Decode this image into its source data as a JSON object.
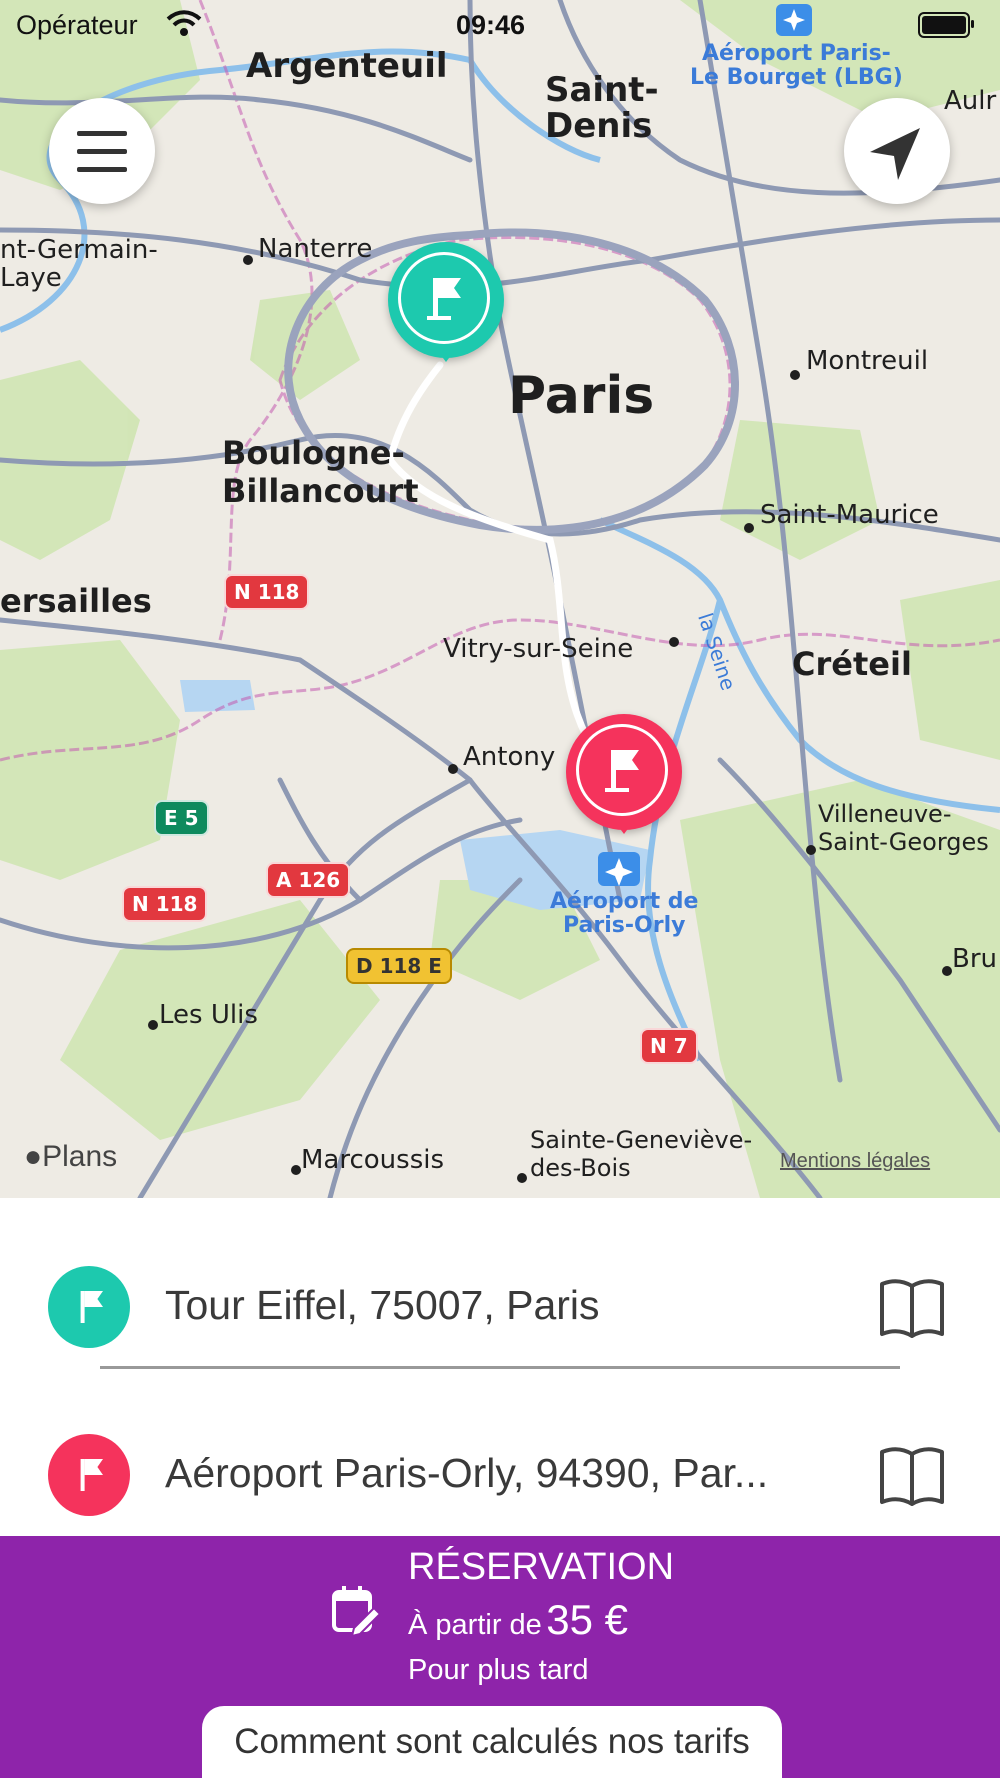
{
  "status_bar": {
    "carrier": "Opérateur",
    "time": "09:46"
  },
  "map": {
    "labels": {
      "argenteuil": "Argenteuil",
      "saint_denis": "Saint-\nDenis",
      "aulnay": "Aulr",
      "le_bourget": "Aéroport Paris-\nLe Bourget (LBG)",
      "st_germain": "nt-Germain-\nLaye",
      "nanterre": "Nanterre",
      "paris": "Paris",
      "montreuil": "Montreuil",
      "boulogne": "Boulogne-\nBillancourt",
      "saint_maurice": "Saint-Maurice",
      "versailles": "ersailles",
      "vitry": "Vitry-sur-Seine",
      "seine": "la Seine",
      "creteil": "Créteil",
      "antony": "Antony",
      "villeneuve": "Villeneuve-\nSaint-Georges",
      "orly": "Aéroport de\nParis-Orly",
      "les_ulis": "Les Ulis",
      "bru": "Bru",
      "marcoussis": "Marcoussis",
      "sainte_genevieve": "Sainte-Geneviève-\ndes-Bois"
    },
    "shields": {
      "n118_a": "N 118",
      "e5": "E 5",
      "a126": "A 126",
      "n118_b": "N 118",
      "d118e": "D 118 E",
      "n7": "N 7"
    },
    "attribution": "Plans",
    "legal": "Mentions légales"
  },
  "addresses": {
    "origin": "Tour Eiffel, 75007, Paris",
    "destination": "Aéroport Paris-Orly, 94390, Par..."
  },
  "colors": {
    "origin": "#1dc9ae",
    "destination": "#f5335c",
    "reserve_bar": "#8e24aa"
  },
  "reservation": {
    "title": "RÉSERVATION",
    "price_prefix": "À partir de",
    "price": "35 €",
    "subtitle": "Pour plus tard",
    "tariffs_button": "Comment sont calculés nos tarifs"
  },
  "icons": [
    "menu-icon",
    "location-arrow-icon",
    "flag-icon",
    "book-icon",
    "calendar-edit-icon",
    "wifi-icon",
    "battery-icon",
    "plane-icon"
  ]
}
